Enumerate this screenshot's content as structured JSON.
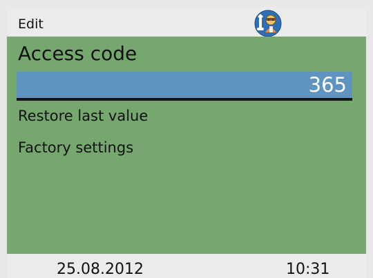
{
  "topbar": {
    "title": "Edit",
    "icon": "service-technician-icon"
  },
  "main": {
    "heading": "Access code",
    "value": "365",
    "menu": [
      {
        "label": "Restore last value"
      },
      {
        "label": "Factory settings"
      }
    ]
  },
  "statusbar": {
    "date": "25.08.2012",
    "time": "10:31"
  },
  "colors": {
    "background": "#76a76f",
    "selection": "#5f93c0",
    "bars": "#ebebeb"
  }
}
